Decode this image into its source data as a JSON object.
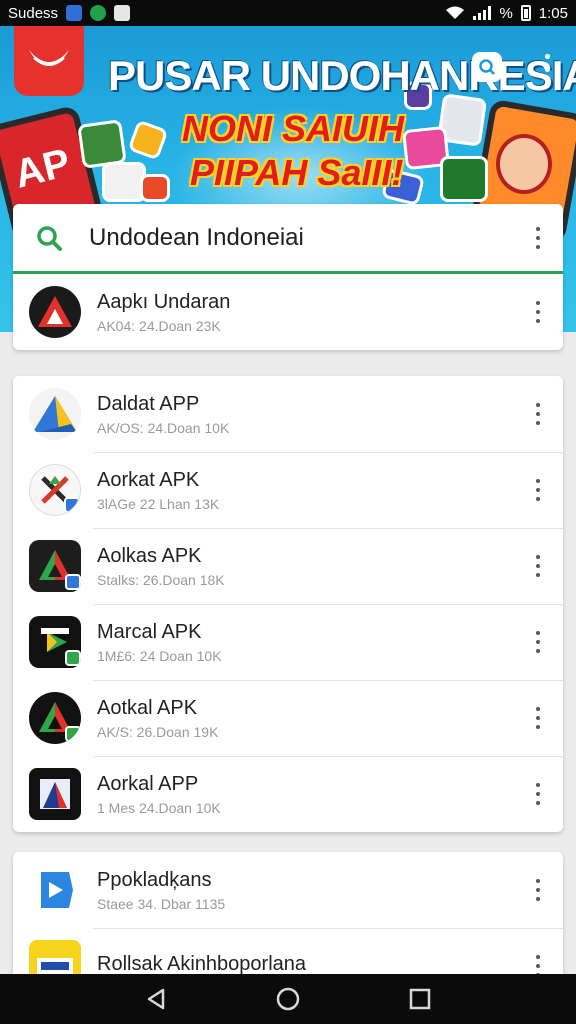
{
  "status_bar": {
    "carrier": "Sudess",
    "time": "1:05",
    "battery_text": "%"
  },
  "banner": {
    "title": "PUSAR UNDOHANRESIA",
    "subtitle_line1": "NONI SAIUIH",
    "subtitle_line2": "PIIPAH SaIII!",
    "phone_text": "AP"
  },
  "search": {
    "query": "Undodean Indoneiai"
  },
  "pinned_item": {
    "title": "Aapkı Undaran",
    "meta": "AK04: 24.Doan 23K"
  },
  "list": [
    {
      "title": "Daldat APP",
      "meta": "AK/OS: 24.Doan 10K",
      "icon": "triangle-blue-yellow-icon"
    },
    {
      "title": "Aorkat APK",
      "meta": "3lAGe 22 Lhan 13K",
      "icon": "cross-arrow-icon"
    },
    {
      "title": "Aolkas APK",
      "meta": "Stalks: 26.Doan 18K",
      "icon": "triangle-multicolor-icon"
    },
    {
      "title": "Marcal APK",
      "meta": "1M£6: 24 Doan 10K",
      "icon": "play-store-icon"
    },
    {
      "title": "Aotkal APK",
      "meta": "AK/S: 26.Doan 19K",
      "icon": "triangle-green-red-icon"
    },
    {
      "title": "Aorkal APP",
      "meta": "1 Mes 24.Doan 10K",
      "icon": "striped-a-icon"
    }
  ],
  "list2": [
    {
      "title": "Ppokladķans",
      "meta": "Staee 34. Dbar 1135",
      "icon": "blue-play-icon"
    },
    {
      "title": "Rollsak Akinhboporlana",
      "meta": "",
      "icon": "yellow-tag-icon"
    }
  ],
  "colors": {
    "banner_top": "#1b9ad6",
    "accent_green": "#2aa552",
    "logo_red": "#e5322d"
  }
}
